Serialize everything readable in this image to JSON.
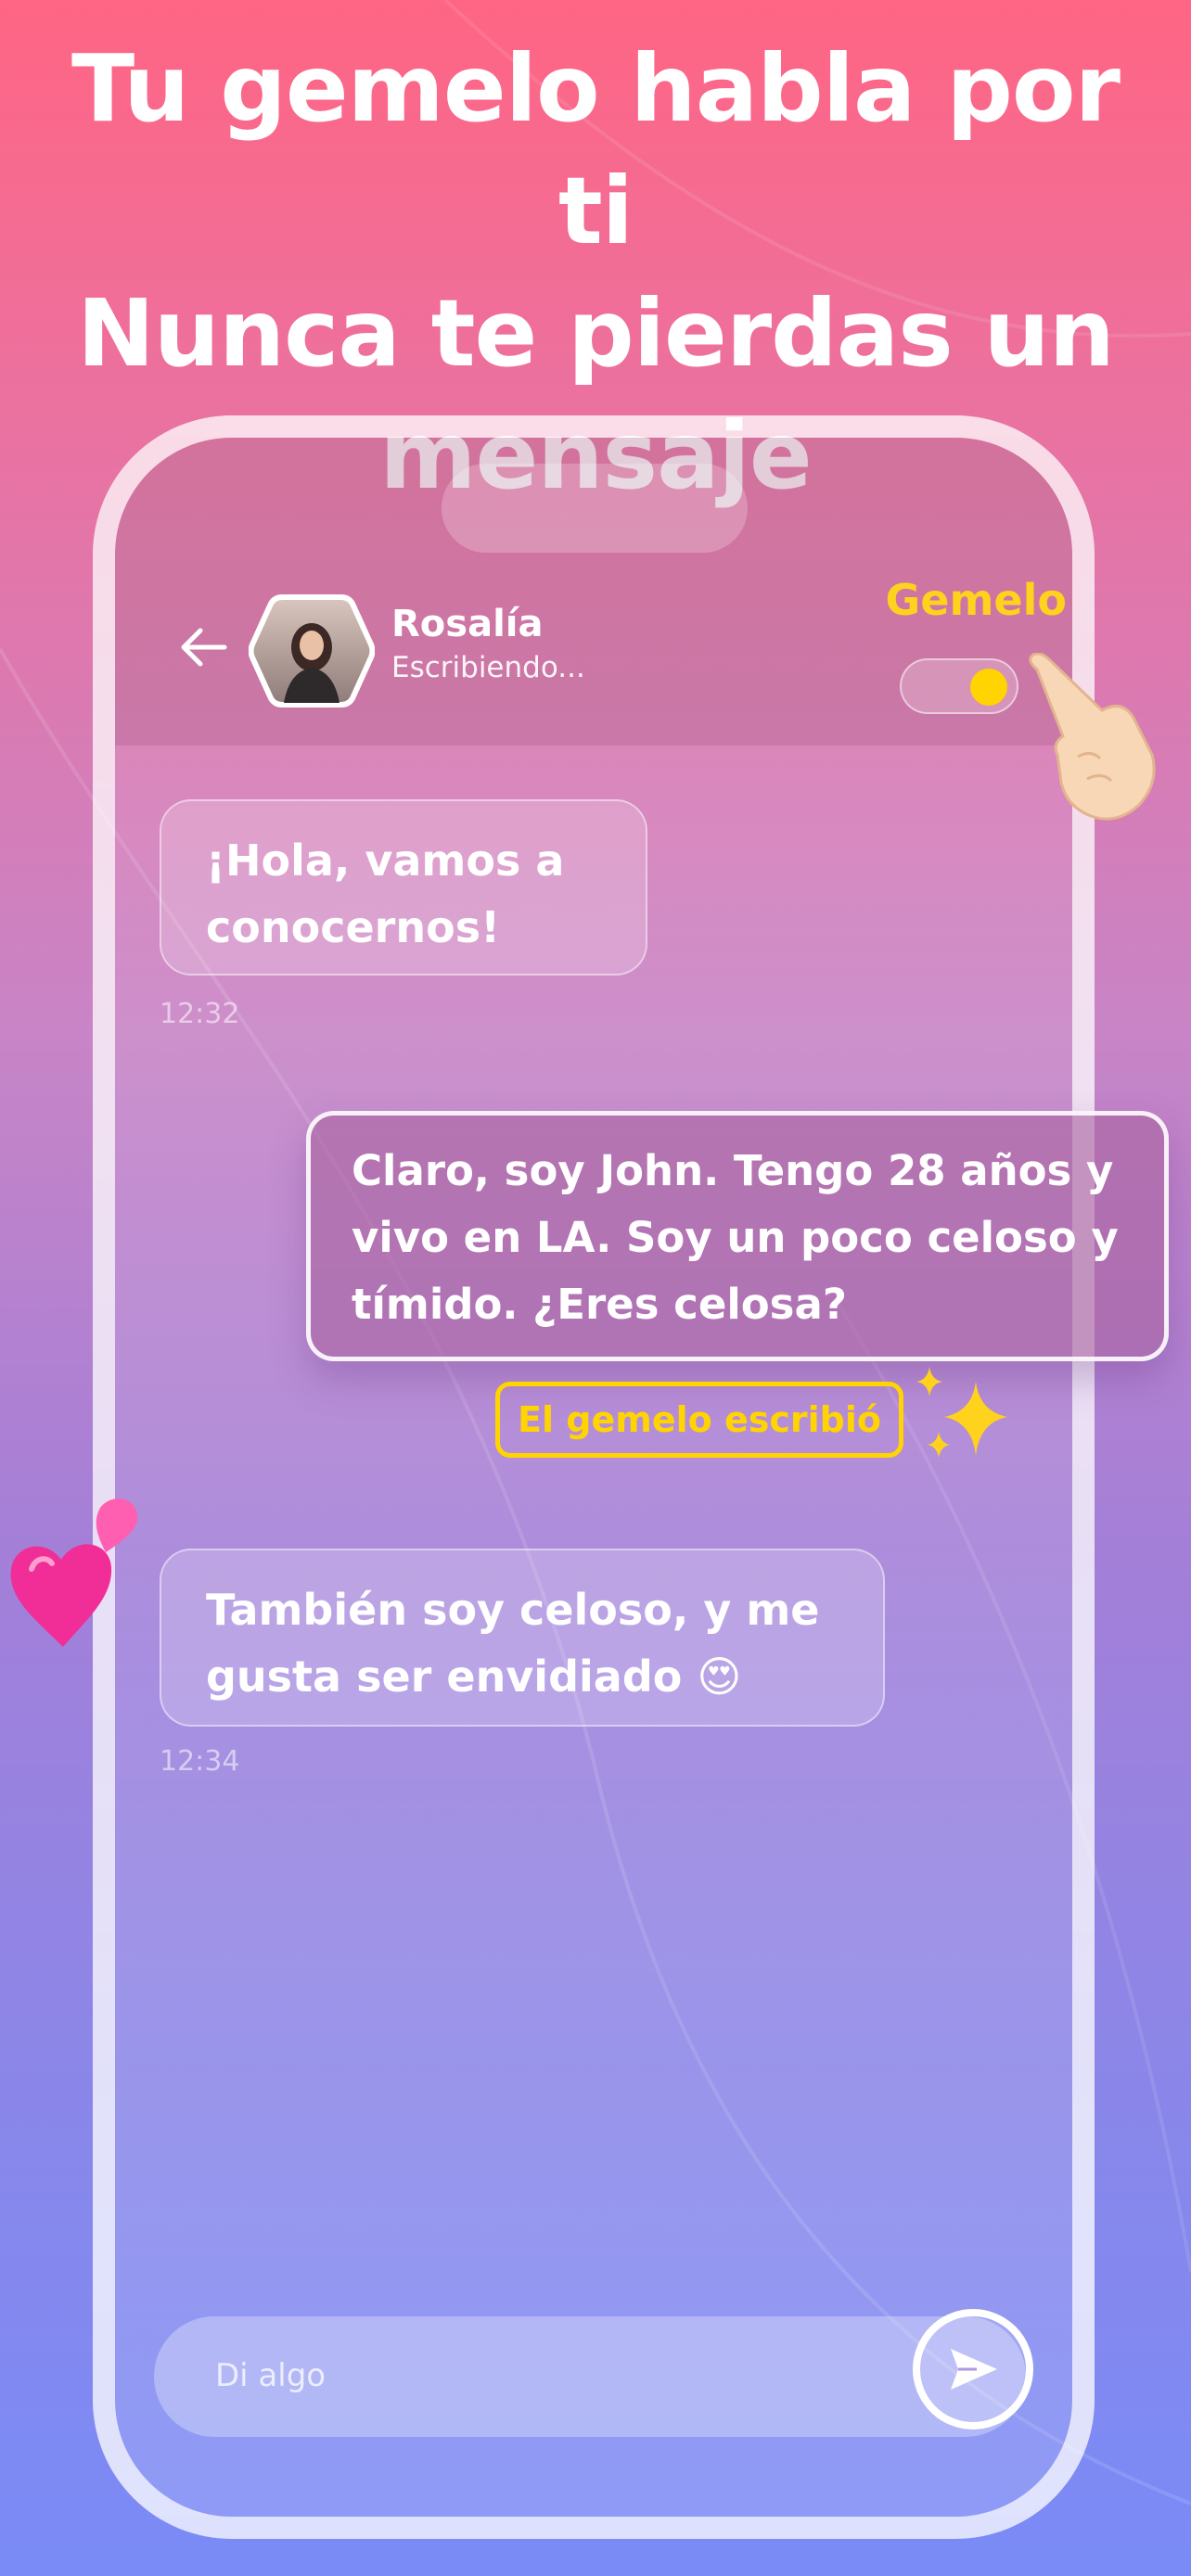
{
  "headline": {
    "line1": "Tu gemelo habla por ti",
    "line2": "Nunca te pierdas un",
    "line3": "mensaje"
  },
  "chat": {
    "contact_name": "Rosalía",
    "contact_status": "Escribiendo...",
    "twin_label": "Gemelo",
    "twin_toggle_on": true,
    "messages": [
      {
        "line1": "¡Hola, vamos a",
        "line2": "conocernos!",
        "time": "12:32"
      },
      {
        "line1": "Claro, soy John. Tengo 28 años y",
        "line2": "vivo en LA. Soy un poco celoso y",
        "line3": "tímido. ¿Eres celosa?",
        "badge": "El gemelo escribió"
      },
      {
        "line1": "También soy celoso, y me",
        "line2": "gusta ser envidiado 😍",
        "time": "12:34"
      }
    ],
    "input_placeholder": "Di algo"
  },
  "colors": {
    "accent_yellow": "#ffd400",
    "gradient_top": "#ff6584",
    "gradient_bottom": "#7a8bf7"
  },
  "icons": {
    "back": "arrow-left-icon",
    "send": "send-icon",
    "sparkles": "sparkles-icon",
    "hearts": "hearts-icon",
    "pointing_hand": "pointing-hand-icon"
  }
}
